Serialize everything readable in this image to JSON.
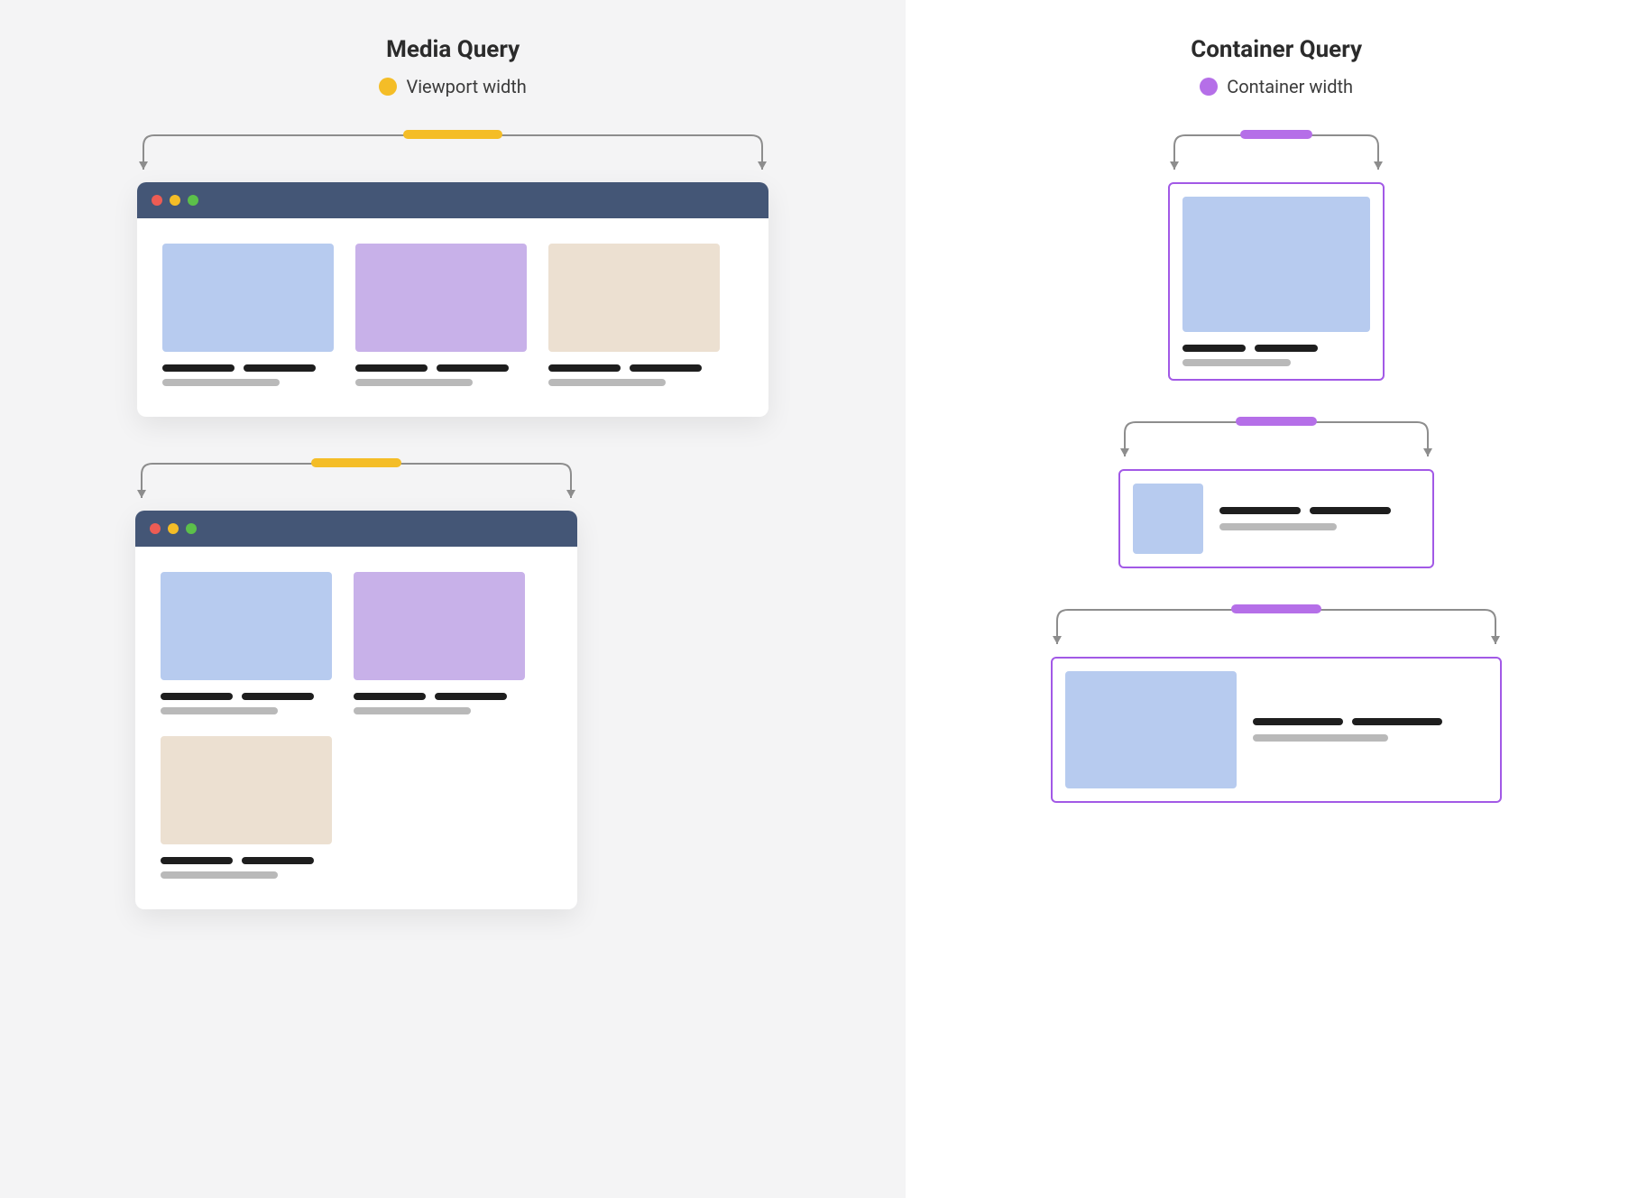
{
  "left": {
    "title": "Media Query",
    "legend_label": "Viewport width",
    "legend_color": "#f4bd27",
    "titlebar_color": "#445676",
    "traffic_lights": {
      "red": "#ed5c54",
      "yellow": "#f4bd27",
      "green": "#5cc04a"
    },
    "card_colors": {
      "blue": "#b7cbef",
      "purple": "#c8b1e9",
      "beige": "#ece0d1"
    }
  },
  "right": {
    "title": "Container Query",
    "legend_label": "Container width",
    "legend_color": "#b56fe8",
    "container_border": "#a259e6",
    "thumb_color": "#b7cbef"
  }
}
